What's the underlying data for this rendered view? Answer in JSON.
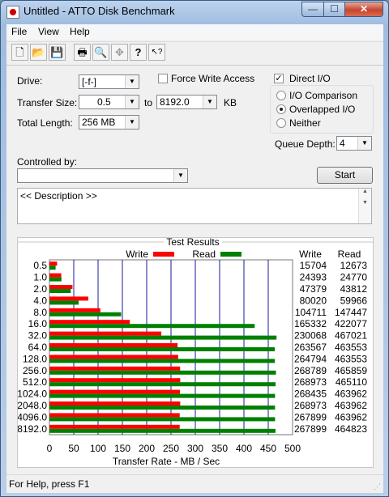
{
  "window": {
    "title": "Untitled - ATTO Disk Benchmark",
    "minimize": "—",
    "maximize": "☐",
    "close": "✕"
  },
  "menu": [
    "File",
    "View",
    "Help"
  ],
  "toolbar": {
    "icons": [
      "new-file-icon",
      "open-folder-icon",
      "save-icon",
      "print-icon",
      "print-preview-icon",
      "move-icon",
      "help-icon",
      "context-help-icon"
    ],
    "glyphs": [
      "🗋",
      "📂",
      "💾",
      "🖶",
      "🔍",
      "✥",
      "?",
      "↖?"
    ]
  },
  "form": {
    "drive_label": "Drive:",
    "drive_value": "[-f-]",
    "transfer_label": "Transfer Size:",
    "transfer_from": "0.5",
    "to_label": "to",
    "transfer_to": "8192.0",
    "unit": "KB",
    "length_label": "Total Length:",
    "length_value": "256 MB",
    "force_write": "Force Write Access",
    "force_write_checked": false,
    "direct_io": "Direct I/O",
    "direct_io_checked": true,
    "radio_io_comparison": "I/O Comparison",
    "radio_overlapped": "Overlapped I/O",
    "radio_neither": "Neither",
    "selected_mode": "Overlapped I/O",
    "queue_label": "Queue Depth:",
    "queue_value": "4",
    "controlled_label": "Controlled by:",
    "controlled_value": "",
    "start": "Start",
    "description": "<< Description >>"
  },
  "results": {
    "title": "Test Results",
    "write_legend": "Write",
    "read_legend": "Read",
    "write_col": "Write",
    "read_col": "Read",
    "xlabel": "Transfer Rate - MB / Sec"
  },
  "chart_data": {
    "type": "bar",
    "categories": [
      "0.5",
      "1.0",
      "2.0",
      "4.0",
      "8.0",
      "16.0",
      "32.0",
      "64.0",
      "128.0",
      "256.0",
      "512.0",
      "1024.0",
      "2048.0",
      "4096.0",
      "8192.0"
    ],
    "series": [
      {
        "name": "Write",
        "color": "#ff0000",
        "values": [
          15704,
          24393,
          47379,
          80020,
          104711,
          165332,
          230068,
          263567,
          264794,
          268789,
          268973,
          268435,
          268973,
          267899,
          267899
        ]
      },
      {
        "name": "Read",
        "color": "#008000",
        "values": [
          12673,
          24770,
          43812,
          59966,
          147447,
          422077,
          467021,
          463553,
          463553,
          465859,
          465110,
          463962,
          463962,
          463962,
          464823
        ]
      }
    ],
    "xlabel": "Transfer Rate - MB / Sec",
    "xlim": [
      0,
      500
    ],
    "xticks": [
      "0",
      "50",
      "100",
      "150",
      "200",
      "250",
      "300",
      "350",
      "400",
      "450",
      "500"
    ],
    "grid": true
  },
  "status": {
    "text": "For Help, press F1"
  }
}
